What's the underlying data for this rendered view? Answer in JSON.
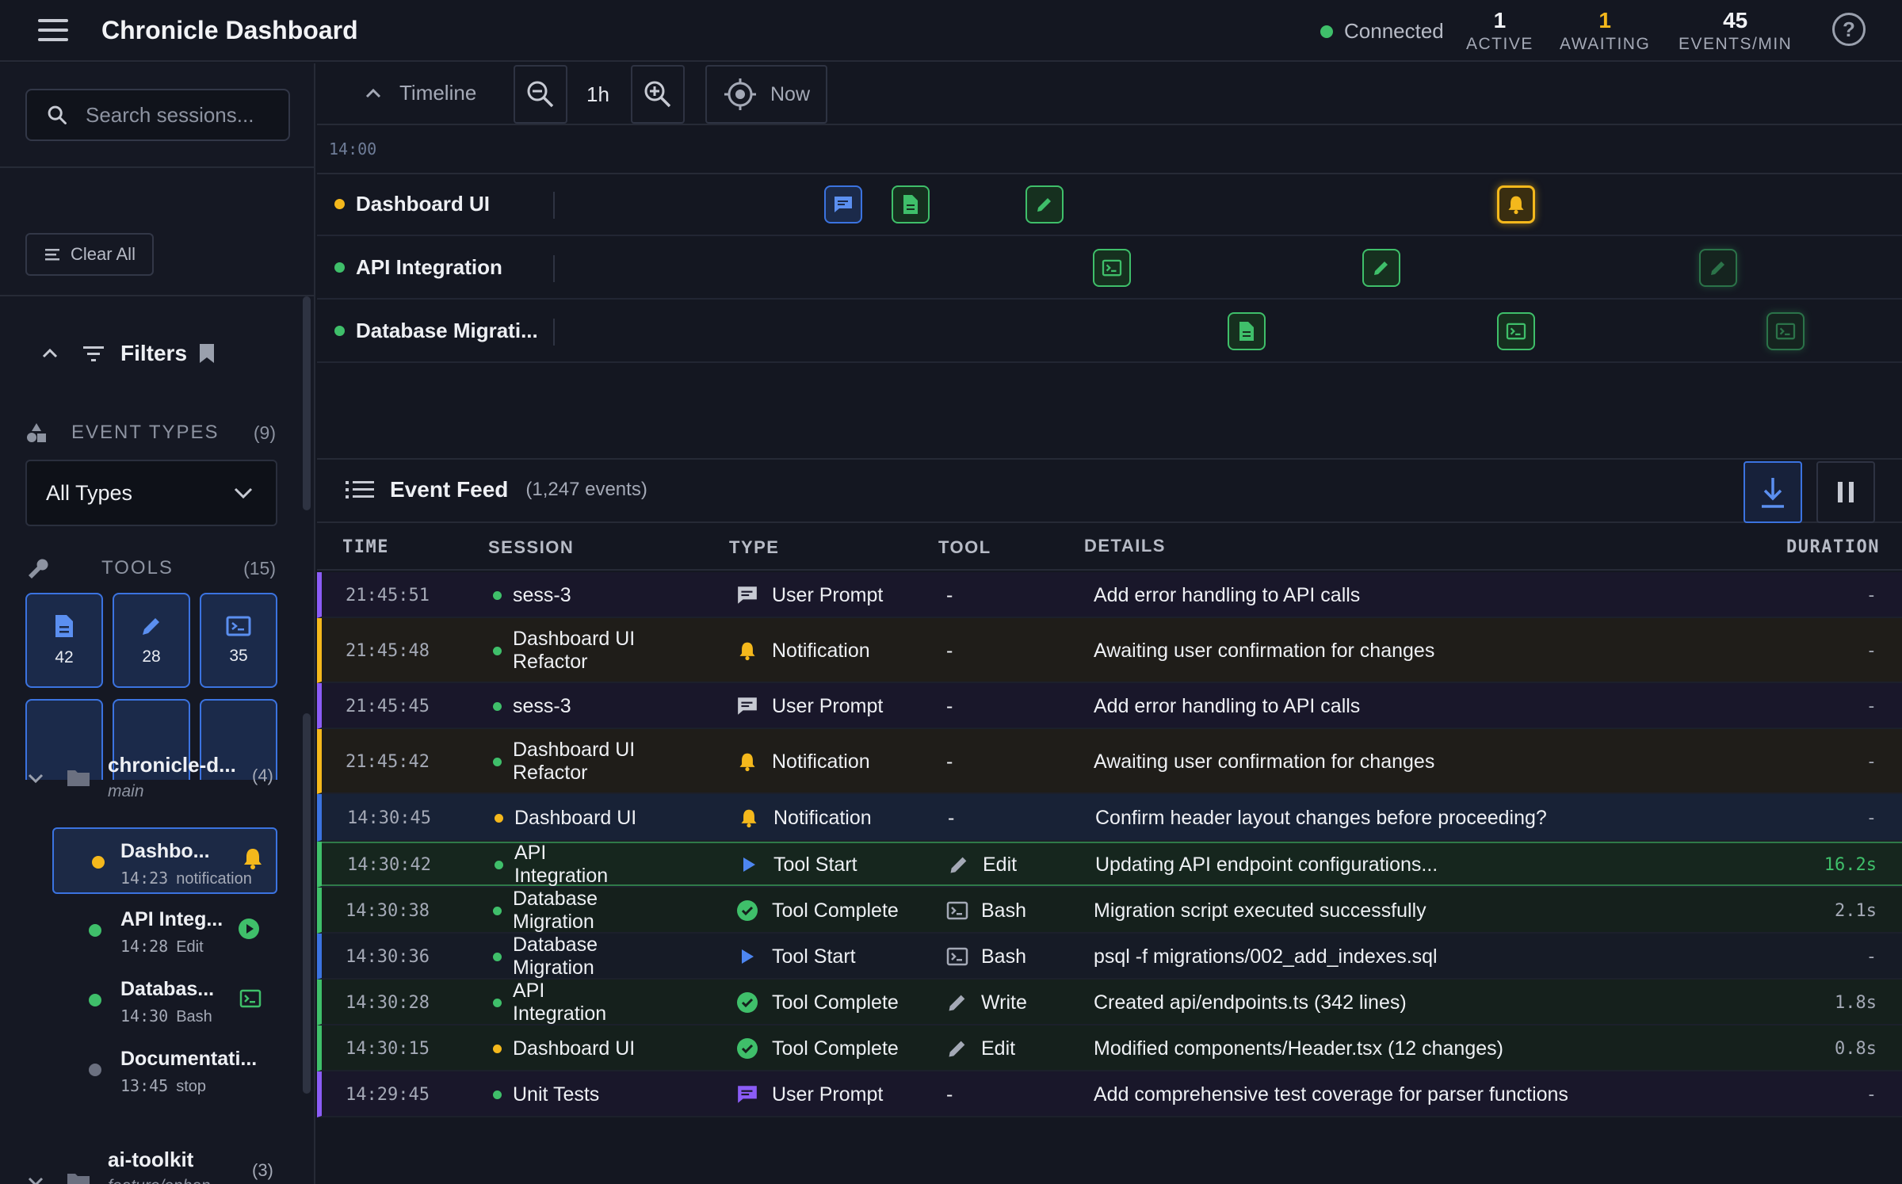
{
  "header": {
    "title": "Chronicle Dashboard",
    "connection": "Connected",
    "stats": [
      {
        "value": "1",
        "label": "ACTIVE",
        "color": "#f2f3f6"
      },
      {
        "value": "1",
        "label": "AWAITING",
        "color": "#f4b81c"
      },
      {
        "value": "45",
        "label": "EVENTS/MIN",
        "color": "#f2f3f6"
      }
    ]
  },
  "sidebar": {
    "search_placeholder": "Search sessions...",
    "clear_all": "Clear All",
    "filters_label": "Filters",
    "event_types_label": "EVENT TYPES",
    "event_types_count": "(9)",
    "event_type_selected": "All Types",
    "tools_label": "TOOLS",
    "tools_count": "(15)",
    "tools": [
      {
        "icon": "file-icon",
        "count": "42"
      },
      {
        "icon": "pencil-icon",
        "count": "28"
      },
      {
        "icon": "terminal-icon",
        "count": "35"
      }
    ],
    "projects": [
      {
        "name": "chronicle-d...",
        "branch": "main",
        "count": "(4)",
        "sessions": [
          {
            "name": "Dashbo...",
            "time": "14:23",
            "event": "notification",
            "status": "#f4b81c"
          },
          {
            "name": "API Integ...",
            "time": "14:28",
            "event": "Edit",
            "status": "#3fbf6a"
          },
          {
            "name": "Databas...",
            "time": "14:30",
            "event": "Bash",
            "status": "#3fbf6a"
          },
          {
            "name": "Documentati...",
            "time": "13:45",
            "event": "stop",
            "status": "#6b7080"
          }
        ]
      },
      {
        "name": "ai-toolkit",
        "branch": "feature/enhan...",
        "count": "(3)"
      }
    ]
  },
  "timeline": {
    "toggle_label": "Timeline",
    "zoom_level": "1h",
    "now_label": "Now",
    "tick": "14:00",
    "lanes": [
      {
        "label": "Dashboard UI",
        "status": "#f4b81c"
      },
      {
        "label": "API Integration",
        "status": "#3fbf6a"
      },
      {
        "label": "Database Migrati...",
        "status": "#3fbf6a"
      }
    ]
  },
  "feed": {
    "title": "Event Feed",
    "count": "(1,247 events)",
    "columns": {
      "time": "TIME",
      "session": "SESSION",
      "type": "TYPE",
      "tool": "TOOL",
      "details": "DETAILS",
      "duration": "DURATION"
    },
    "rows": [
      {
        "time": "21:45:51",
        "session": "sess-3",
        "type": "User Prompt",
        "tool": "-",
        "details": "Add error handling to API calls",
        "duration": "-"
      },
      {
        "time": "21:45:48",
        "session": "Dashboard UI Refactor",
        "type": "Notification",
        "tool": "-",
        "details": "Awaiting user confirmation for changes",
        "duration": "-"
      },
      {
        "time": "21:45:45",
        "session": "sess-3",
        "type": "User Prompt",
        "tool": "-",
        "details": "Add error handling to API calls",
        "duration": "-"
      },
      {
        "time": "21:45:42",
        "session": "Dashboard UI Refactor",
        "type": "Notification",
        "tool": "-",
        "details": "Awaiting user confirmation for changes",
        "duration": "-"
      },
      {
        "time": "14:30:45",
        "session": "Dashboard UI",
        "type": "Notification",
        "tool": "-",
        "details": "Confirm header layout changes before proceeding?",
        "duration": "-"
      },
      {
        "time": "14:30:42",
        "session": "API Integration",
        "type": "Tool Start",
        "tool": "Edit",
        "details": "Updating API endpoint configurations...",
        "duration": "16.2s"
      },
      {
        "time": "14:30:38",
        "session": "Database Migration",
        "type": "Tool Complete",
        "tool": "Bash",
        "details": "Migration script executed successfully",
        "duration": "2.1s"
      },
      {
        "time": "14:30:36",
        "session": "Database Migration",
        "type": "Tool Start",
        "tool": "Bash",
        "details": "psql -f migrations/002_add_indexes.sql",
        "duration": "-"
      },
      {
        "time": "14:30:28",
        "session": "API Integration",
        "type": "Tool Complete",
        "tool": "Write",
        "details": "Created api/endpoints.ts (342 lines)",
        "duration": "1.8s"
      },
      {
        "time": "14:30:15",
        "session": "Dashboard UI",
        "type": "Tool Complete",
        "tool": "Edit",
        "details": "Modified components/Header.tsx (12 changes)",
        "duration": "0.8s"
      },
      {
        "time": "14:29:45",
        "session": "Unit Tests",
        "type": "User Prompt",
        "tool": "-",
        "details": "Add comprehensive test coverage for parser functions",
        "duration": "-"
      }
    ]
  },
  "colors": {
    "accent": "#3b73e0",
    "success": "#3fbf6a",
    "warning": "#f4b81c",
    "prompt": "#8b5cf6"
  }
}
